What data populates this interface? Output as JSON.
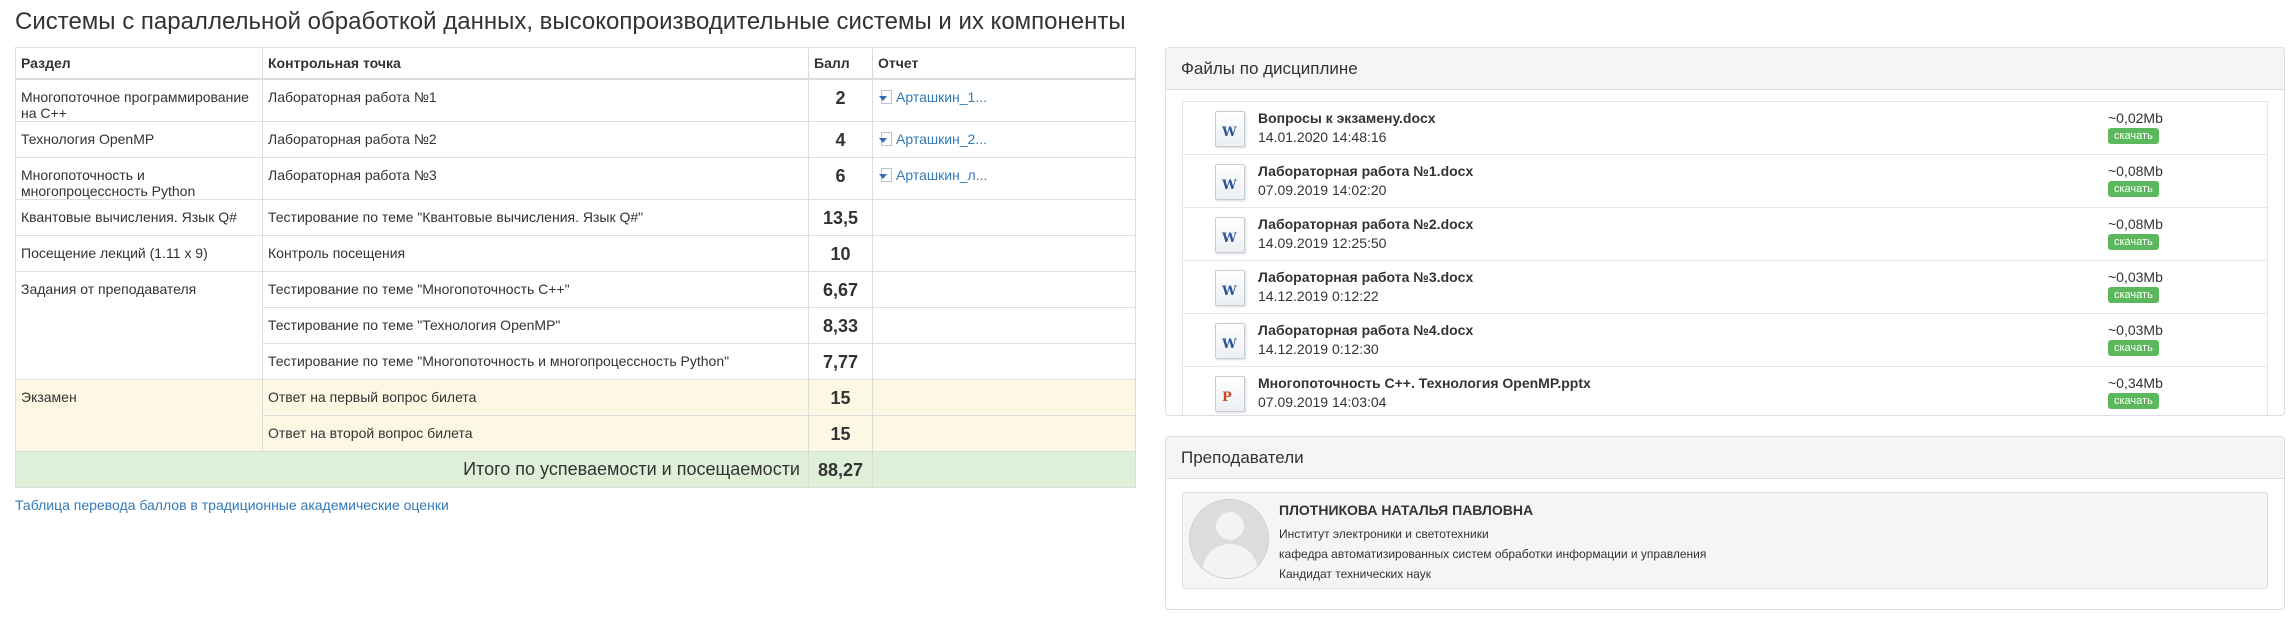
{
  "page_title": "Системы с параллельной обработкой данных, высокопроизводительные системы и их компоненты",
  "grades_table": {
    "headers": [
      "Раздел",
      "Контрольная точка",
      "Балл",
      "Отчет"
    ],
    "rows": [
      {
        "section": "Многопоточное программирование на С++",
        "checkpoint": "Лабораторная работа №1",
        "score": "2",
        "report": "Арташкин_1..."
      },
      {
        "section": "Технология OpenMP",
        "checkpoint": "Лабораторная работа №2",
        "score": "4",
        "report": "Арташкин_2..."
      },
      {
        "section": "Многопоточность и многопроцессность Python",
        "checkpoint": "Лабораторная работа №3",
        "score": "6",
        "report": "Арташкин_л..."
      },
      {
        "section": "Квантовые вычисления. Язык Q#",
        "checkpoint": "Тестирование по теме \"Квантовые вычисления. Язык Q#\"",
        "score": "13,5",
        "report": ""
      },
      {
        "section": "Посещение лекций (1.11 x 9)",
        "checkpoint": "Контроль посещения",
        "score": "10",
        "report": ""
      },
      {
        "section": "Задания от преподавателя",
        "checkpoint": "Тестирование по теме \"Многопоточность С++\"",
        "score": "6,67",
        "report": ""
      },
      {
        "section": "",
        "checkpoint": "Тестирование по теме \"Технология OpenMP\"",
        "score": "8,33",
        "report": ""
      },
      {
        "section": "",
        "checkpoint": "Тестирование по теме \"Многопоточность и многопроцессность Python\"",
        "score": "7,77",
        "report": ""
      },
      {
        "section": "Экзамен",
        "checkpoint": "Ответ на первый вопрос билета",
        "score": "15",
        "report": ""
      },
      {
        "section": "",
        "checkpoint": "Ответ на второй вопрос билета",
        "score": "15",
        "report": ""
      }
    ],
    "total_label": "Итого по успеваемости и посещаемости",
    "total_score": "88,27"
  },
  "conversion_link": "Таблица перевода баллов в традиционные академические оценки",
  "files_panel": {
    "title": "Файлы по дисциплине",
    "download_label": "скачать",
    "files": [
      {
        "name": "Вопросы к экзамену.docx",
        "date": "14.01.2020 14:48:16",
        "size": "~0,02Mb",
        "icon": "word-doc-icon"
      },
      {
        "name": "Лабораторная работа №1.docx",
        "date": "07.09.2019 14:02:20",
        "size": "~0,08Mb",
        "icon": "word-doc-icon"
      },
      {
        "name": "Лабораторная работа №2.docx",
        "date": "14.09.2019 12:25:50",
        "size": "~0,08Mb",
        "icon": "word-doc-icon"
      },
      {
        "name": "Лабораторная работа №3.docx",
        "date": "14.12.2019 0:12:22",
        "size": "~0,03Mb",
        "icon": "word-doc-icon"
      },
      {
        "name": "Лабораторная работа №4.docx",
        "date": "14.12.2019 0:12:30",
        "size": "~0,03Mb",
        "icon": "word-doc-icon"
      },
      {
        "name": "Многопоточность С++. Технология OpenMP.pptx",
        "date": "07.09.2019 14:03:04",
        "size": "~0,34Mb",
        "icon": "powerpoint-icon"
      }
    ]
  },
  "teachers_panel": {
    "title": "Преподаватели",
    "teacher": {
      "name": "ПЛОТНИКОВА НАТАЛЬЯ ПАВЛОВНА",
      "institute": "Институт электроники и светотехники",
      "department": "кафедра автоматизированных систем обработки информации и управления",
      "degree": "Кандидат технических наук"
    }
  },
  "colors": {
    "link": "#337ab7",
    "exam_row_bg": "#fcf8e3",
    "total_row_bg": "#dff0d8",
    "download_button": "#5cb85c",
    "panel_heading_bg": "#f5f5f5"
  }
}
